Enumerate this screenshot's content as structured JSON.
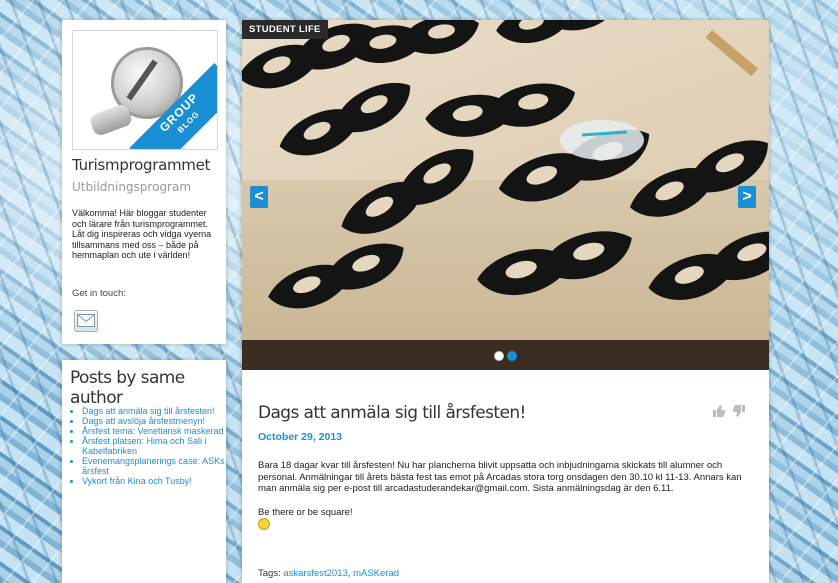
{
  "profile": {
    "logo_ribbon_main": "GROUP",
    "logo_ribbon_sub": "BLOG",
    "title": "Turismprogrammet",
    "type": "Utbildningsprogram",
    "description": "Välkomma! Här bloggar studenter och lärare från turismprogrammet. Låt dig inspireras och vidga vyerna tillsammans med oss – både på hemmaplan och ute i världen!",
    "get_in_touch": "Get in touch:"
  },
  "posts_by_author": {
    "heading": "Posts by same author",
    "items": [
      "Dags att anmäla sig till årsfesten!",
      "Dags att avslöja årsfestmenyn!",
      "Årsfest tema: Venetiansk maskerad",
      "Årsfest platsen: Hima och Sali i Kabelfabriken",
      "Evenemangsplanerings case: ASKs årsfest",
      "Vykort från Kina och Tusby!"
    ]
  },
  "slider": {
    "category": "STUDENT LIFE",
    "prev_label": "<",
    "next_label": ">"
  },
  "post": {
    "title": "Dags att anmäla sig till årsfesten!",
    "date": "October 29, 2013",
    "paragraph1": "Bara 18 dagar kvar till årsfesten! Nu har plancherna blivit uppsatta och inbjudningarna skickats till alumner och personal. Anmälningar till årets bästa fest tas emot på Arcadas stora torg onsdagen den 30.10 kl 11-13. Annars kan man anmäla sig per e-post till arcadastuderandekar@gmail.com. Sista anmälningsdag är den 6.11.",
    "paragraph2": "Be there or be square!",
    "tags_label": "Tags:",
    "tags": [
      "askarsfest2013",
      "mASKerad"
    ]
  },
  "colors": {
    "accent": "#1a8fd4"
  }
}
